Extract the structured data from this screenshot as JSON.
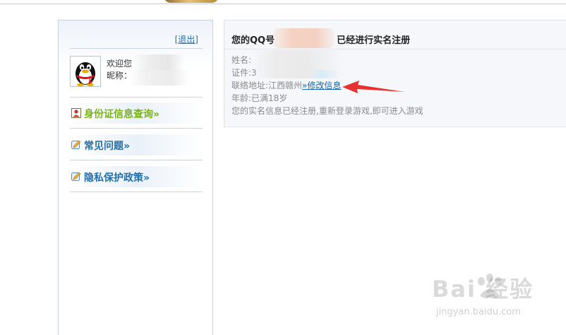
{
  "header": {
    "logo_icon": "game-logo-fragment"
  },
  "sidebar": {
    "logout_label": "[退出]",
    "user": {
      "avatar_icon": "qq-penguin-icon",
      "welcome_label": "欢迎您",
      "nickname_label": "昵称："
    },
    "nav": [
      {
        "label": "身份证信息查询»",
        "icon": "id-card-icon",
        "color": "#7ab317"
      },
      {
        "label": "常见问题»",
        "icon": "pencil-icon",
        "color": "#1f6fae"
      },
      {
        "label": "隐私保护政策»",
        "icon": "pencil-icon",
        "color": "#1f6fae"
      }
    ]
  },
  "panel": {
    "title_prefix": "您的QQ号",
    "title_suffix": "已经进行实名注册",
    "name_label": "姓名:",
    "id_label": "证件:3",
    "address_label": "联络地址:江西赣州",
    "edit_link_label": "»修改信息",
    "age_label": "年龄:已满18岁",
    "notice": "您的实名信息已经注册,重新登录游戏,即可进入游戏"
  },
  "annotation": {
    "arrow_color": "#e8322f"
  },
  "watermark": {
    "brand": "Bai  经验",
    "url": "jingyan.baidu.com"
  },
  "colors": {
    "link": "#1565b5",
    "sidebar_border": "#c5d3e2",
    "panel_bg": "#f5f7fb"
  }
}
